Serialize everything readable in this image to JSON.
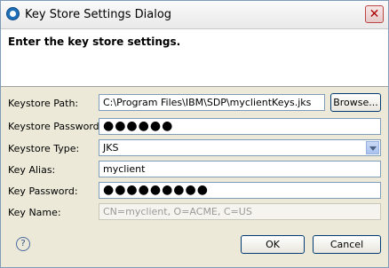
{
  "window": {
    "title": "Key Store Settings Dialog",
    "close_glyph": "✕"
  },
  "header": {
    "text": "Enter the key store settings."
  },
  "form": {
    "keystore_path": {
      "label": "Keystore Path:",
      "value": "C:\\Program Files\\IBM\\SDP\\myclientKeys.jks"
    },
    "browse_label": "Browse...",
    "keystore_password": {
      "label": "Keystore Password:",
      "value": "●●●●●●"
    },
    "keystore_type": {
      "label": "Keystore Type:",
      "value": "JKS"
    },
    "key_alias": {
      "label": "Key Alias:",
      "value": "myclient"
    },
    "key_password": {
      "label": "Key Password:",
      "value": "●●●●●●●●●"
    },
    "key_name": {
      "label": "Key Name:",
      "value": "CN=myclient, O=ACME, C=US"
    }
  },
  "buttons": {
    "ok": "OK",
    "cancel": "Cancel",
    "help": "?"
  }
}
